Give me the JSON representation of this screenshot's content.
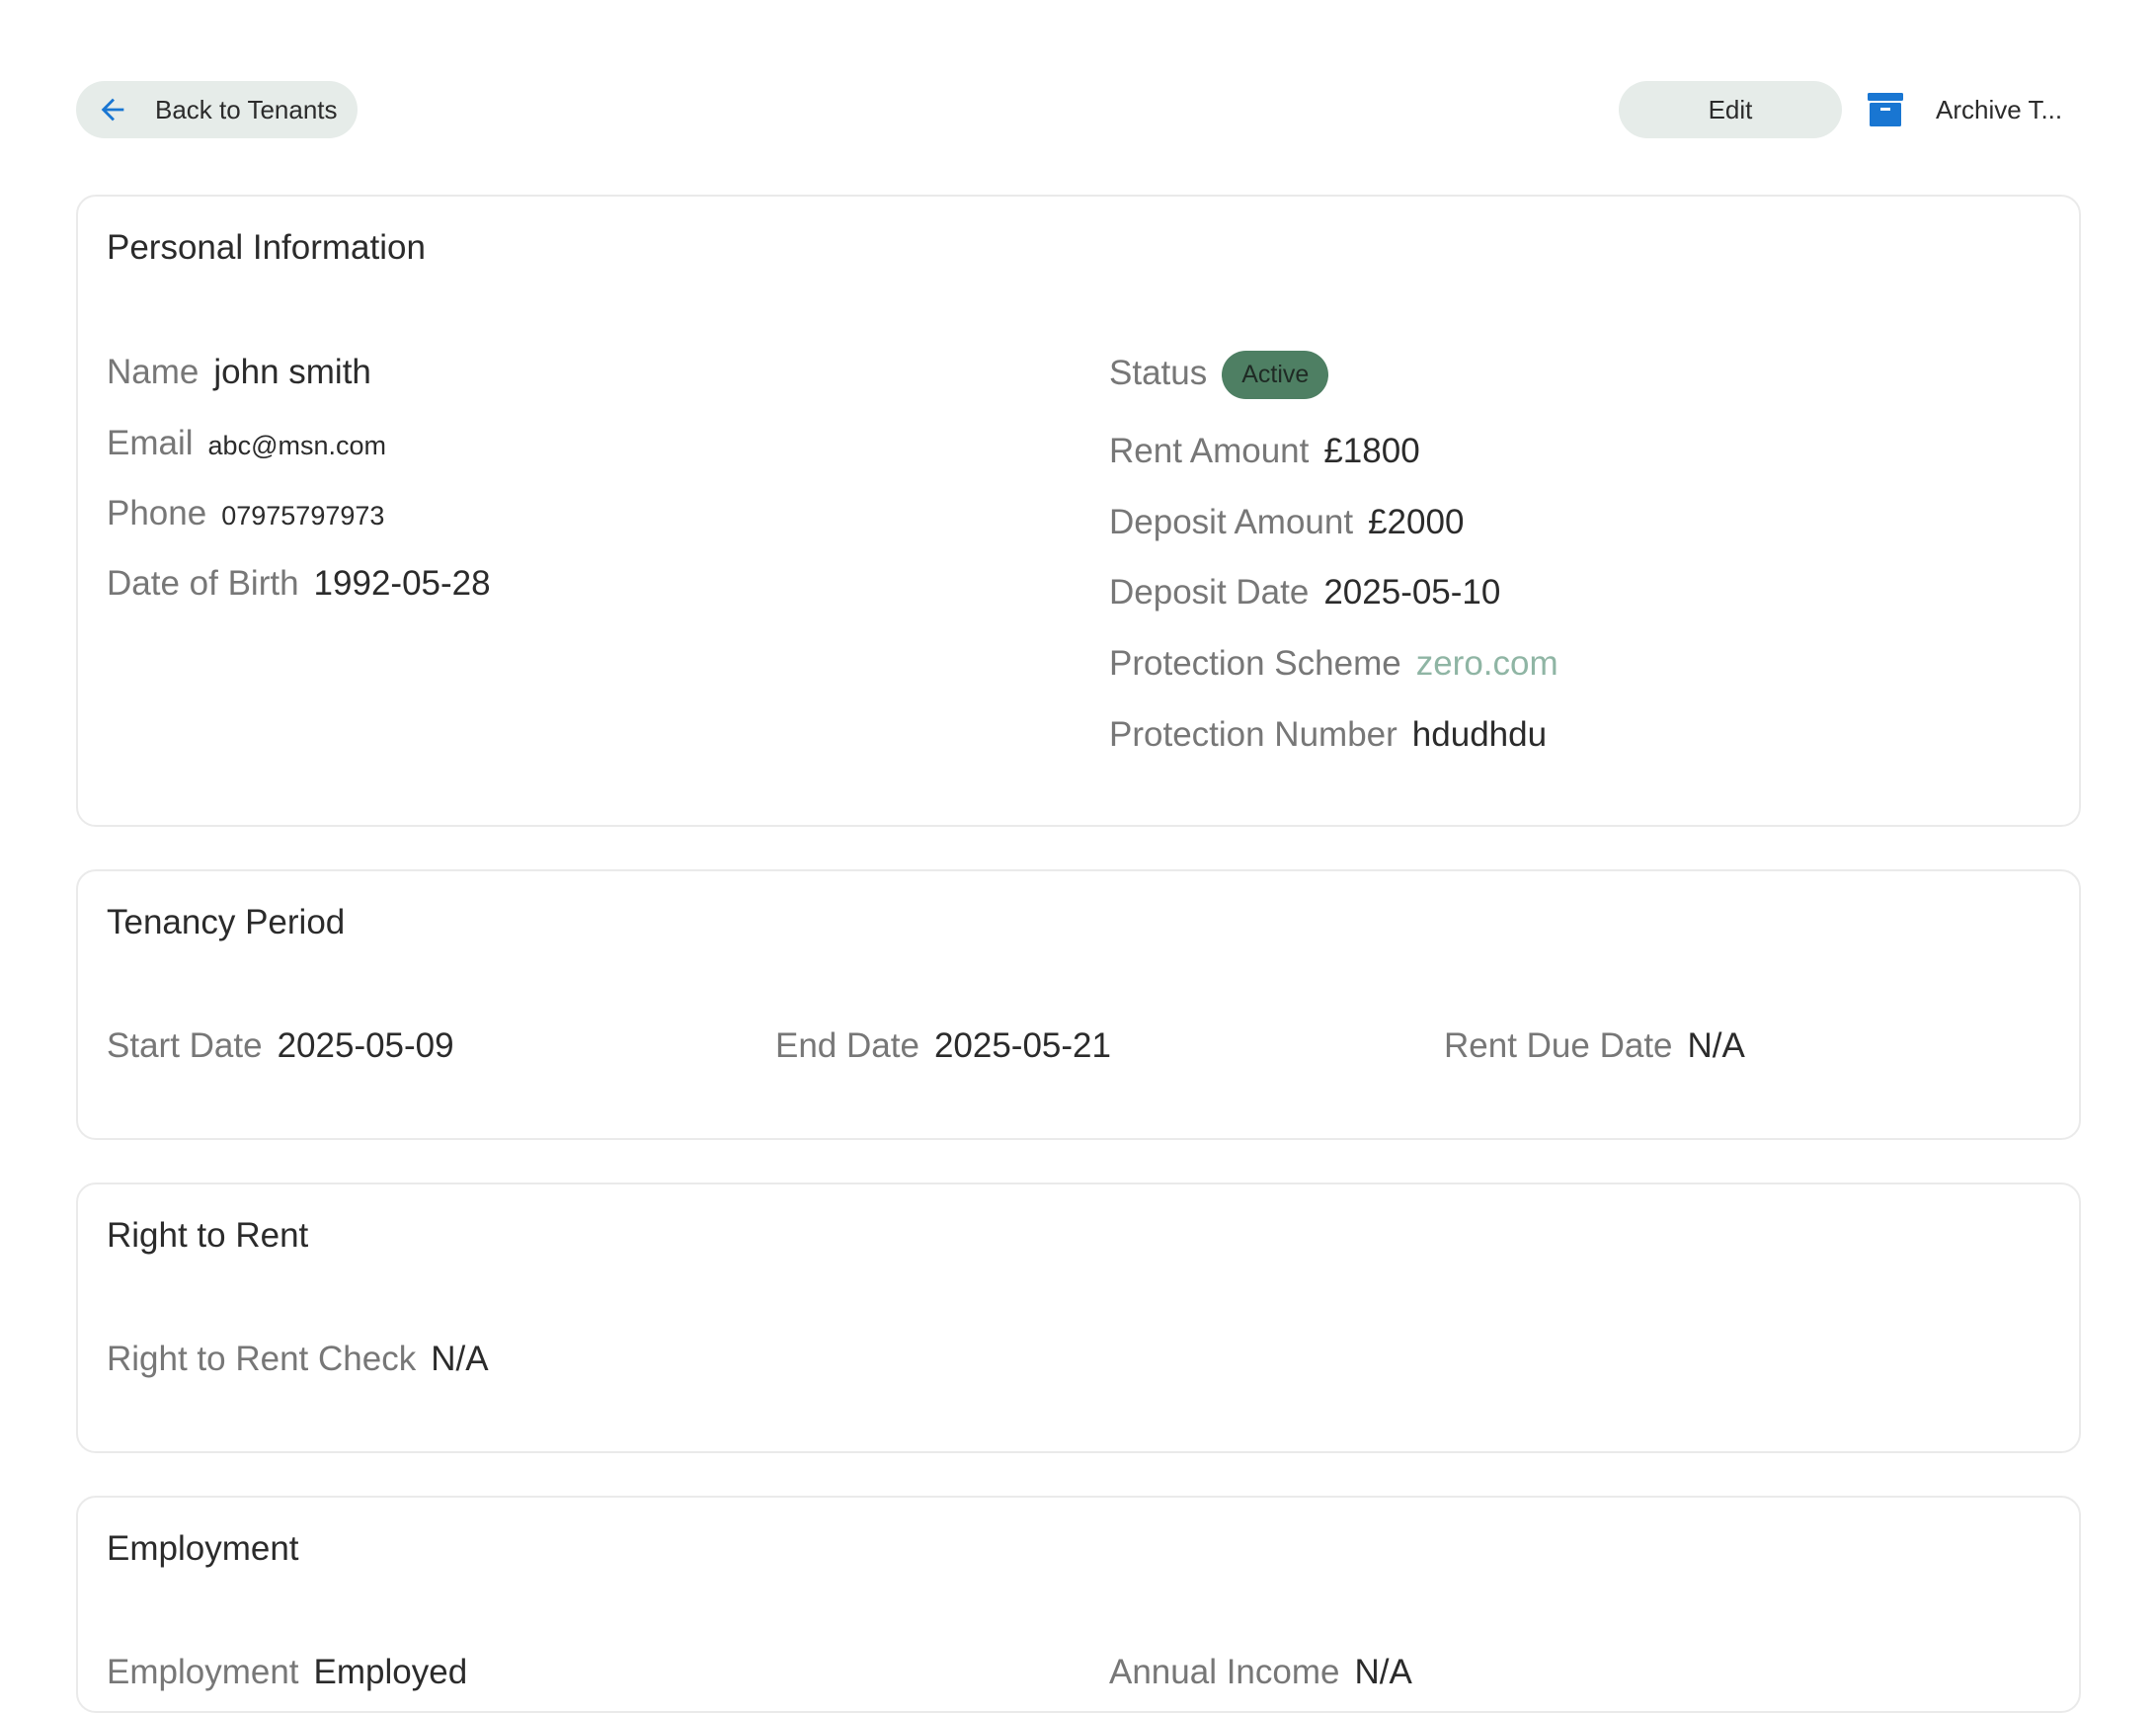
{
  "toolbar": {
    "back_label": "Back to Tenants",
    "edit_label": "Edit",
    "archive_label": "Archive T..."
  },
  "icons": {
    "back": "arrow-left-icon",
    "archive": "archive-box-icon"
  },
  "colors": {
    "accent_blue": "#1976d2",
    "status_active_bg": "#4e7f63",
    "link_green": "#8fb5a4",
    "pill_bg": "#e6ece9"
  },
  "personal": {
    "title": "Personal Information",
    "name_label": "Name",
    "name_value": "john smith",
    "email_label": "Email",
    "email_value": "abc@msn.com",
    "phone_label": "Phone",
    "phone_value": "07975797973",
    "dob_label": "Date of Birth",
    "dob_value": "1992-05-28",
    "status_label": "Status",
    "status_value": "Active",
    "rent_label": "Rent Amount",
    "rent_value": "£1800",
    "deposit_label": "Deposit Amount",
    "deposit_value": "£2000",
    "deposit_date_label": "Deposit Date",
    "deposit_date_value": "2025-05-10",
    "scheme_label": "Protection Scheme",
    "scheme_value": "zero.com",
    "protection_no_label": "Protection Number",
    "protection_no_value": "hdudhdu"
  },
  "tenancy": {
    "title": "Tenancy Period",
    "start_label": "Start Date",
    "start_value": "2025-05-09",
    "end_label": "End Date",
    "end_value": "2025-05-21",
    "due_label": "Rent Due Date",
    "due_value": "N/A"
  },
  "right_to_rent": {
    "title": "Right to Rent",
    "check_label": "Right to Rent Check",
    "check_value": "N/A"
  },
  "employment": {
    "title": "Employment",
    "employment_label": "Employment",
    "employment_value": "Employed",
    "income_label": "Annual Income",
    "income_value": "N/A"
  }
}
